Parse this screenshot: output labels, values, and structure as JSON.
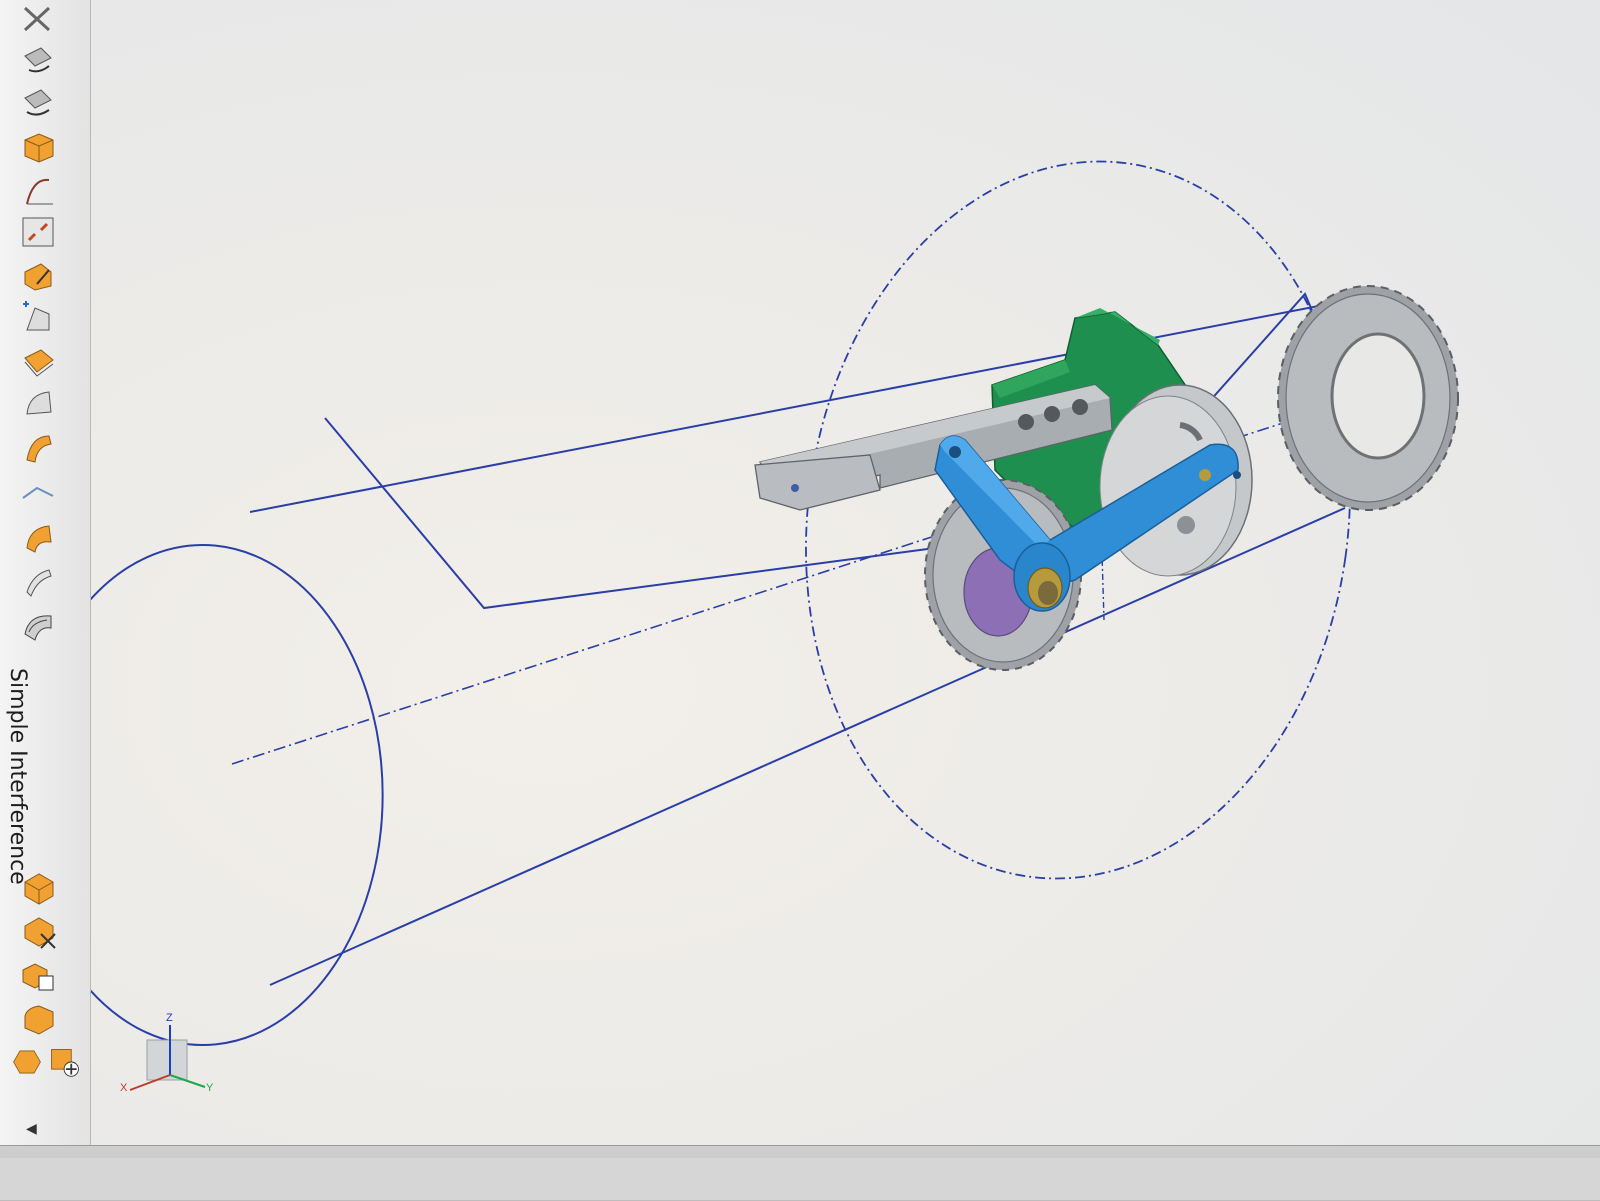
{
  "toolbar": {
    "label": "Simple Interference",
    "tools": [
      {
        "name": "delete-tool-icon"
      },
      {
        "name": "move-component-icon"
      },
      {
        "name": "assembly-constraint-icon"
      },
      {
        "name": "solid-body-icon"
      },
      {
        "name": "curve-icon"
      },
      {
        "name": "scale-fit-icon"
      },
      {
        "name": "edit-body-icon"
      },
      {
        "name": "add-surface-icon"
      },
      {
        "name": "sheet-body-icon"
      },
      {
        "name": "face-blend-icon"
      },
      {
        "name": "curved-face-icon"
      },
      {
        "name": "profile-curve-icon"
      },
      {
        "name": "offset-face-icon"
      },
      {
        "name": "thin-sheet-icon"
      },
      {
        "name": "rounded-face-icon"
      }
    ],
    "tools_bottom": [
      {
        "name": "solid-cube-icon"
      },
      {
        "name": "remove-body-icon"
      },
      {
        "name": "copy-body-icon"
      },
      {
        "name": "rounded-block-icon"
      },
      {
        "name": "hexagon-body-icon"
      },
      {
        "name": "add-component-icon"
      }
    ]
  },
  "triad": {
    "z": "Z",
    "x": "X",
    "y": "Y"
  },
  "colors": {
    "sketch_line": "#2a3ea8",
    "bracket": "#1e8f4e",
    "arm": "#2f8ed6",
    "sprocket": "#b9bcbf",
    "steel": "#9ea2a6",
    "bushing": "#b79a3c",
    "disc": "#8c6fb5"
  }
}
